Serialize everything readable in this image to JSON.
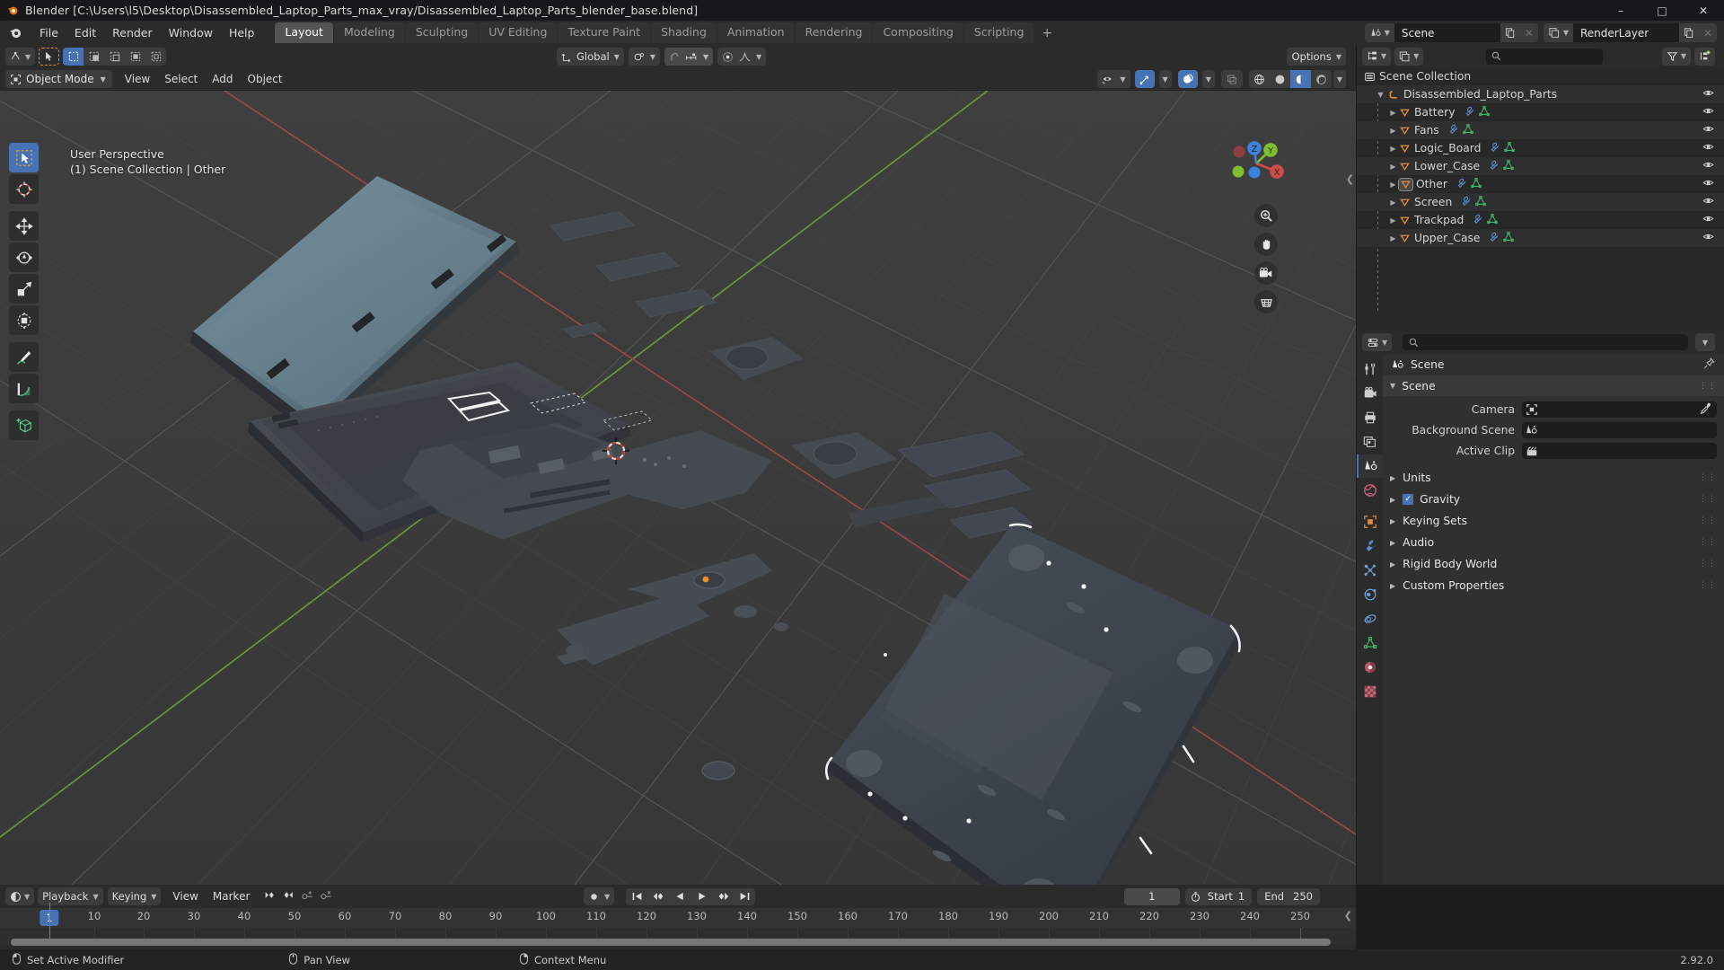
{
  "window": {
    "title": "Blender [C:\\Users\\l5\\Desktop\\Disassembled_Laptop_Parts_max_vray/Disassembled_Laptop_Parts_blender_base.blend]",
    "minimize": "–",
    "maximize": "□",
    "close": "✕"
  },
  "menus": [
    "File",
    "Edit",
    "Render",
    "Window",
    "Help"
  ],
  "workspace_tabs": [
    {
      "label": "Layout",
      "active": true
    },
    {
      "label": "Modeling",
      "active": false
    },
    {
      "label": "Sculpting",
      "active": false
    },
    {
      "label": "UV Editing",
      "active": false
    },
    {
      "label": "Texture Paint",
      "active": false
    },
    {
      "label": "Shading",
      "active": false
    },
    {
      "label": "Animation",
      "active": false
    },
    {
      "label": "Rendering",
      "active": false
    },
    {
      "label": "Compositing",
      "active": false
    },
    {
      "label": "Scripting",
      "active": false
    },
    {
      "label": "+",
      "active": false
    }
  ],
  "scene_selector": {
    "scene_name": "Scene",
    "view_layer_name": "RenderLayer"
  },
  "viewport": {
    "mode": "Object Mode",
    "menus": [
      "View",
      "Select",
      "Add",
      "Object"
    ],
    "transform_orientation": "Global",
    "options_label": "Options",
    "overlay_text_line1": "User Perspective",
    "overlay_text_line2": "(1) Scene Collection | Other",
    "gizmo_axes": [
      "X",
      "Y",
      "Z"
    ],
    "tools": [
      "select-box-tool",
      "cursor-tool",
      "move-tool",
      "rotate-tool",
      "scale-tool",
      "transform-tool",
      "annotate-tool",
      "measure-tool",
      "add-cube-tool"
    ]
  },
  "outliner": {
    "filter_placeholder": "",
    "root": "Scene Collection",
    "collection": "Disassembled_Laptop_Parts",
    "items": [
      {
        "label": "Battery",
        "selected": false
      },
      {
        "label": "Fans",
        "selected": false
      },
      {
        "label": "Logic_Board",
        "selected": false
      },
      {
        "label": "Lower_Case",
        "selected": false
      },
      {
        "label": "Other",
        "selected": true
      },
      {
        "label": "Screen",
        "selected": false
      },
      {
        "label": "Trackpad",
        "selected": false
      },
      {
        "label": "Upper_Case",
        "selected": false
      }
    ]
  },
  "properties": {
    "search_placeholder": "",
    "breadcrumb": "Scene",
    "panels": [
      {
        "title": "Scene",
        "open": true,
        "checkbox": null
      },
      {
        "title": "Units",
        "open": false,
        "checkbox": null
      },
      {
        "title": "Gravity",
        "open": false,
        "checkbox": true
      },
      {
        "title": "Keying Sets",
        "open": false,
        "checkbox": null
      },
      {
        "title": "Audio",
        "open": false,
        "checkbox": null
      },
      {
        "title": "Rigid Body World",
        "open": false,
        "checkbox": null
      },
      {
        "title": "Custom Properties",
        "open": false,
        "checkbox": null
      }
    ],
    "scene_fields": [
      {
        "label": "Camera",
        "value": "",
        "icon": "camera-data-icon"
      },
      {
        "label": "Background Scene",
        "value": "",
        "icon": "scene-icon"
      },
      {
        "label": "Active Clip",
        "value": "",
        "icon": "clip-icon"
      }
    ],
    "tabs": [
      "tool-tab",
      "render-tab",
      "output-tab",
      "view-layer-tab",
      "scene-tab",
      "world-tab",
      "object-tab",
      "modifier-tab",
      "particles-tab",
      "physics-tab",
      "constraints-tab",
      "data-tab",
      "material-tab",
      "texture-tab"
    ]
  },
  "timeline": {
    "editor_menus": [
      "Playback",
      "Keying",
      "View",
      "Marker"
    ],
    "current_frame": "1",
    "start_label": "Start",
    "start_value": "1",
    "end_label": "End",
    "end_value": "250",
    "ticks": [
      10,
      20,
      30,
      40,
      50,
      60,
      70,
      80,
      90,
      100,
      110,
      120,
      130,
      140,
      150,
      160,
      170,
      180,
      190,
      200,
      210,
      220,
      230,
      240,
      250
    ],
    "frame_range_min": 1,
    "frame_range_max": 260
  },
  "statusbar": {
    "items": [
      {
        "label": "Set Active Modifier",
        "mouse": "left"
      },
      {
        "label": "Pan View",
        "mouse": "middle"
      },
      {
        "label": "Context Menu",
        "mouse": "right"
      }
    ],
    "version": "2.92.0"
  },
  "colors": {
    "accent_blue": "#4772b3",
    "collection_orange": "#e08a3c",
    "mesh_green": "#41b36a",
    "modifier_blue": "#5d8ecb",
    "axis_x_red": "#d14a4a",
    "axis_y_green": "#7fbf2f",
    "axis_z_blue": "#3d83dd",
    "viewport_bg": "#3b3b3b",
    "panel_bg": "#2b2b2b"
  }
}
